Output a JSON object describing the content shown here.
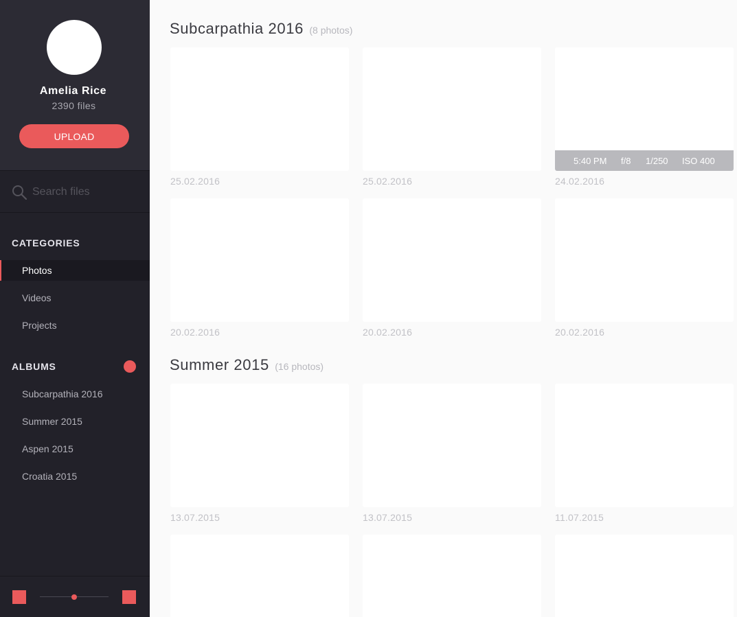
{
  "profile": {
    "name": "Amelia Rice",
    "files": "2390 files",
    "upload_label": "UPLOAD"
  },
  "search": {
    "placeholder": "Search files"
  },
  "categories": {
    "title": "CATEGORIES",
    "items": [
      {
        "label": "Photos",
        "active": true
      },
      {
        "label": "Videos",
        "active": false
      },
      {
        "label": "Projects",
        "active": false
      }
    ]
  },
  "albums": {
    "title": "ALBUMS",
    "items": [
      "Subcarpathia 2016",
      "Summer 2015",
      "Aspen 2015",
      "Croatia 2015"
    ]
  },
  "colors": {
    "accent": "#ea5a5b",
    "sidebar": "#222129",
    "profile_bg": "#2c2b34"
  },
  "thumbnail_size": {
    "level": 0.5
  },
  "gallery": [
    {
      "title": "Subcarpathia 2016",
      "count": "(8 photos)",
      "photos": [
        {
          "date": "25.02.2016"
        },
        {
          "date": "25.02.2016"
        },
        {
          "date": "24.02.2016",
          "exif": {
            "time": "5:40 PM",
            "aperture": "f/8",
            "shutter": "1/250",
            "iso": "ISO 400"
          }
        },
        {
          "date": "20.02.2016"
        },
        {
          "date": "20.02.2016"
        },
        {
          "date": "20.02.2016"
        }
      ]
    },
    {
      "title": "Summer 2015",
      "count": "(16 photos)",
      "photos": [
        {
          "date": "13.07.2015"
        },
        {
          "date": "13.07.2015"
        },
        {
          "date": "11.07.2015"
        },
        {
          "date": ""
        },
        {
          "date": ""
        },
        {
          "date": ""
        }
      ]
    }
  ]
}
